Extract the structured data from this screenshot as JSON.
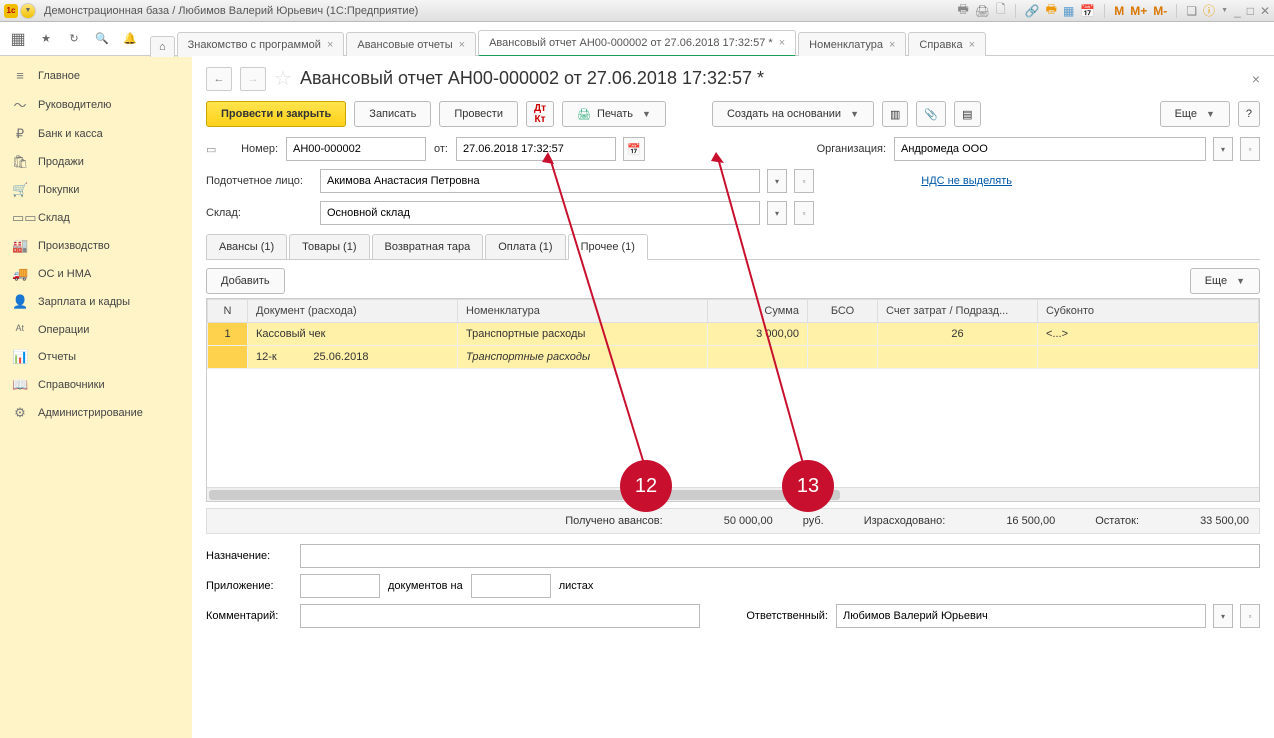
{
  "titlebar": {
    "title": "Демонстрационная база / Любимов Валерий Юрьевич  (1С:Предприятие)",
    "m1": "M",
    "m2": "M+",
    "m3": "M-"
  },
  "tabs": [
    {
      "label": "Знакомство с программой"
    },
    {
      "label": "Авансовые отчеты"
    },
    {
      "label": "Авансовый отчет АН00-000002 от 27.06.2018 17:32:57 *",
      "active": true
    },
    {
      "label": "Номенклатура"
    },
    {
      "label": "Справка"
    }
  ],
  "sidebar": [
    {
      "icon": "≡",
      "label": "Главное"
    },
    {
      "icon": "〜",
      "label": "Руководителю"
    },
    {
      "icon": "₽",
      "label": "Банк и касса"
    },
    {
      "icon": "🛍",
      "label": "Продажи"
    },
    {
      "icon": "🛒",
      "label": "Покупки"
    },
    {
      "icon": "▭▭",
      "label": "Склад"
    },
    {
      "icon": "🏭",
      "label": "Производство"
    },
    {
      "icon": "🚚",
      "label": "ОС и НМА"
    },
    {
      "icon": "👤",
      "label": "Зарплата и кадры"
    },
    {
      "icon": "ᴬᵗ",
      "label": "Операции"
    },
    {
      "icon": "📊",
      "label": "Отчеты"
    },
    {
      "icon": "📖",
      "label": "Справочники"
    },
    {
      "icon": "⚙",
      "label": "Администрирование"
    }
  ],
  "doc": {
    "title": "Авансовый отчет АН00-000002 от 27.06.2018 17:32:57 *",
    "buttons": {
      "post_close": "Провести и закрыть",
      "write": "Записать",
      "post": "Провести",
      "print": "Печать",
      "create_by": "Создать на основании",
      "more": "Еще"
    },
    "number_label": "Номер:",
    "number": "АН00-000002",
    "from_label": "от:",
    "date": "27.06.2018 17:32:57",
    "org_label": "Организация:",
    "org": "Андромеда ООО",
    "person_label": "Подотчетное лицо:",
    "person": "Акимова Анастасия Петровна",
    "vat_link": "НДС не выделять",
    "warehouse_label": "Склад:",
    "warehouse": "Основной склад",
    "doc_tabs": [
      {
        "label": "Авансы (1)"
      },
      {
        "label": "Товары (1)"
      },
      {
        "label": "Возвратная тара"
      },
      {
        "label": "Оплата (1)"
      },
      {
        "label": "Прочее (1)",
        "active": true
      }
    ],
    "add_btn": "Добавить",
    "more_btn": "Еще",
    "columns": [
      "N",
      "Документ (расхода)",
      "Номенклатура",
      "Сумма",
      "БСО",
      "Счет затрат / Подразд...",
      "Субконто"
    ],
    "rows": [
      {
        "n": "1",
        "doc": "Кассовый чек",
        "nomen": "Транспортные расходы",
        "sum": "3 000,00",
        "bso": "",
        "acct": "26",
        "sub": "<...>"
      },
      {
        "n": "",
        "doc": "12-к",
        "date2": "25.06.2018",
        "nomen_i": "Транспортные расходы",
        "sum": "",
        "bso": "",
        "acct": "",
        "sub": ""
      }
    ],
    "summary": {
      "advance_label": "Получено авансов:",
      "advance": "50 000,00",
      "cur": "руб.",
      "spent_label": "Израсходовано:",
      "spent": "16 500,00",
      "remain_label": "Остаток:",
      "remain": "33 500,00"
    },
    "purpose_label": "Назначение:",
    "attach_label": "Приложение:",
    "docs_on": "документов на",
    "sheets": "листах",
    "comment_label": "Комментарий:",
    "resp_label": "Ответственный:",
    "resp": "Любимов Валерий Юрьевич"
  },
  "annotations": {
    "c1": "12",
    "c2": "13"
  }
}
